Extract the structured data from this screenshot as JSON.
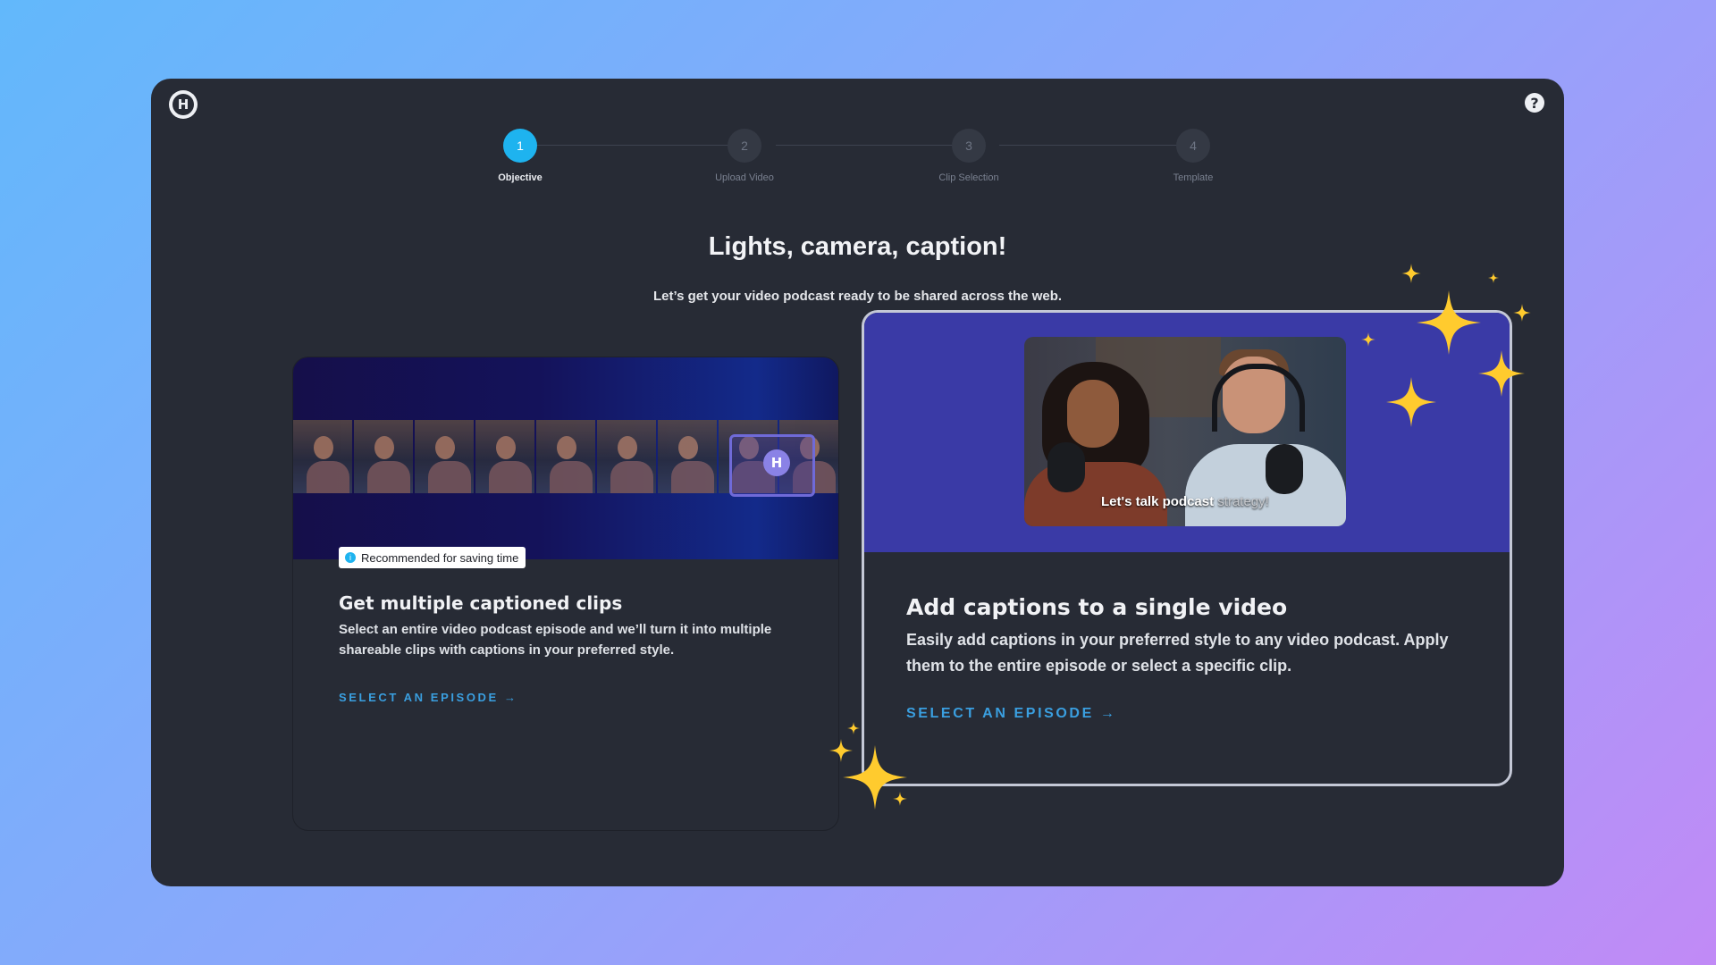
{
  "app": {
    "logo_letter": "H",
    "help_symbol": "?"
  },
  "stepper": {
    "steps": [
      {
        "number": "1",
        "label": "Objective",
        "active": true
      },
      {
        "number": "2",
        "label": "Upload Video",
        "active": false
      },
      {
        "number": "3",
        "label": "Clip Selection",
        "active": false
      },
      {
        "number": "4",
        "label": "Template",
        "active": false
      }
    ]
  },
  "main": {
    "headline": "Lights, camera, caption!",
    "subhead": "Let’s get your video podcast ready to be shared across the web."
  },
  "cards": {
    "multiple": {
      "badge": "Recommended for saving time",
      "badge_icon": "info-icon",
      "title": "Get multiple captioned clips",
      "description": "Select an entire video podcast episode and we’ll turn it into multiple shareable clips with captions in your preferred style.",
      "cta": "SELECT AN EPISODE →",
      "film_badge": "H"
    },
    "single": {
      "caption_main": "Let's talk podcast ",
      "caption_dim": "strategy!",
      "title": "Add captions to a single video",
      "description": "Easily add captions in your preferred style to any video podcast. Apply them to the entire episode or select a specific clip.",
      "cta": "SELECT AN EPISODE →"
    }
  },
  "colors": {
    "accent": "#1eb3ef",
    "cta": "#3a9fe0",
    "sparkle": "#ffcb2e",
    "card_highlight_border": "#c4c8d6"
  }
}
